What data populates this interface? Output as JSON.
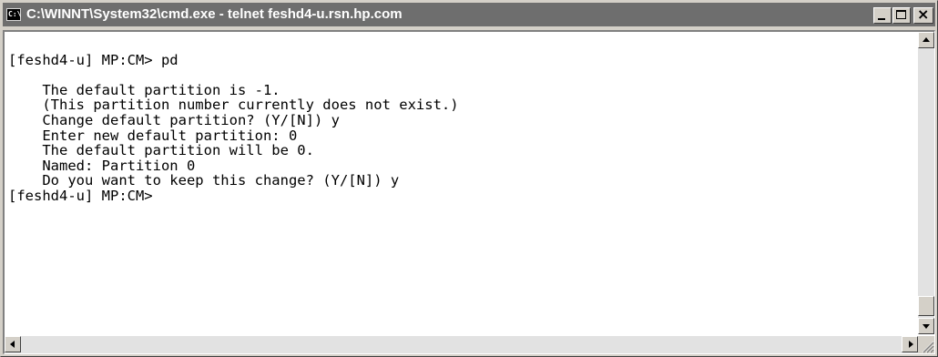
{
  "window": {
    "title": "C:\\WINNT\\System32\\cmd.exe - telnet feshd4-u.rsn.hp.com",
    "icon": "console-window-icon",
    "icon_glyph": "C:\\",
    "controls": {
      "minimize_icon": "minimize-icon",
      "maximize_icon": "maximize-icon",
      "close_icon": "close-icon",
      "close_glyph": "×"
    }
  },
  "console": {
    "lines": [
      "",
      "[feshd4-u] MP:CM> pd",
      "",
      "    The default partition is -1.",
      "    (This partition number currently does not exist.)",
      "    Change default partition? (Y/[N]) y",
      "    Enter new default partition: 0",
      "    The default partition will be 0.",
      "    Named: Partition 0",
      "    Do you want to keep this change? (Y/[N]) y",
      "[feshd4-u] MP:CM>"
    ]
  },
  "scrollbars": {
    "vertical": {
      "position": 0.95
    },
    "horizontal": {
      "position": 0.0
    }
  },
  "colors": {
    "titlebar": "#6e6e6e",
    "title_text": "#ffffff",
    "console_bg": "#ffffff",
    "console_text": "#000000",
    "chrome": "#d4d0c8"
  }
}
